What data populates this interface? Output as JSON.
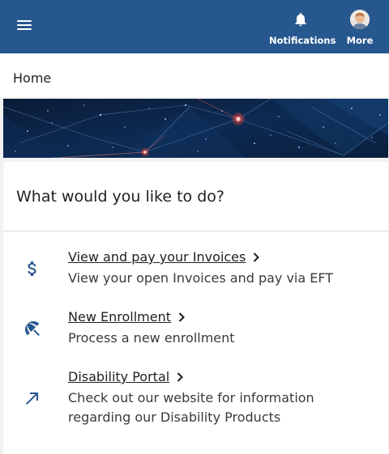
{
  "topbar": {
    "notifications_label": "Notifications",
    "more_label": "More"
  },
  "breadcrumb": {
    "label": "Home"
  },
  "card": {
    "title": "What would you like to do?",
    "actions": [
      {
        "title": "View and pay your Invoices",
        "desc": "View your open Invoices and pay via EFT",
        "icon": "dollar-icon"
      },
      {
        "title": "New Enrollment",
        "desc": "Process a new enrollment",
        "icon": "umbrella-icon"
      },
      {
        "title": "Disability Portal",
        "desc": "Check out our website for information regarding our Disability Products",
        "icon": "arrow-up-right-icon"
      }
    ]
  },
  "colors": {
    "header": "#27578f",
    "icon": "#27578f",
    "banner": "#0a1a33"
  }
}
